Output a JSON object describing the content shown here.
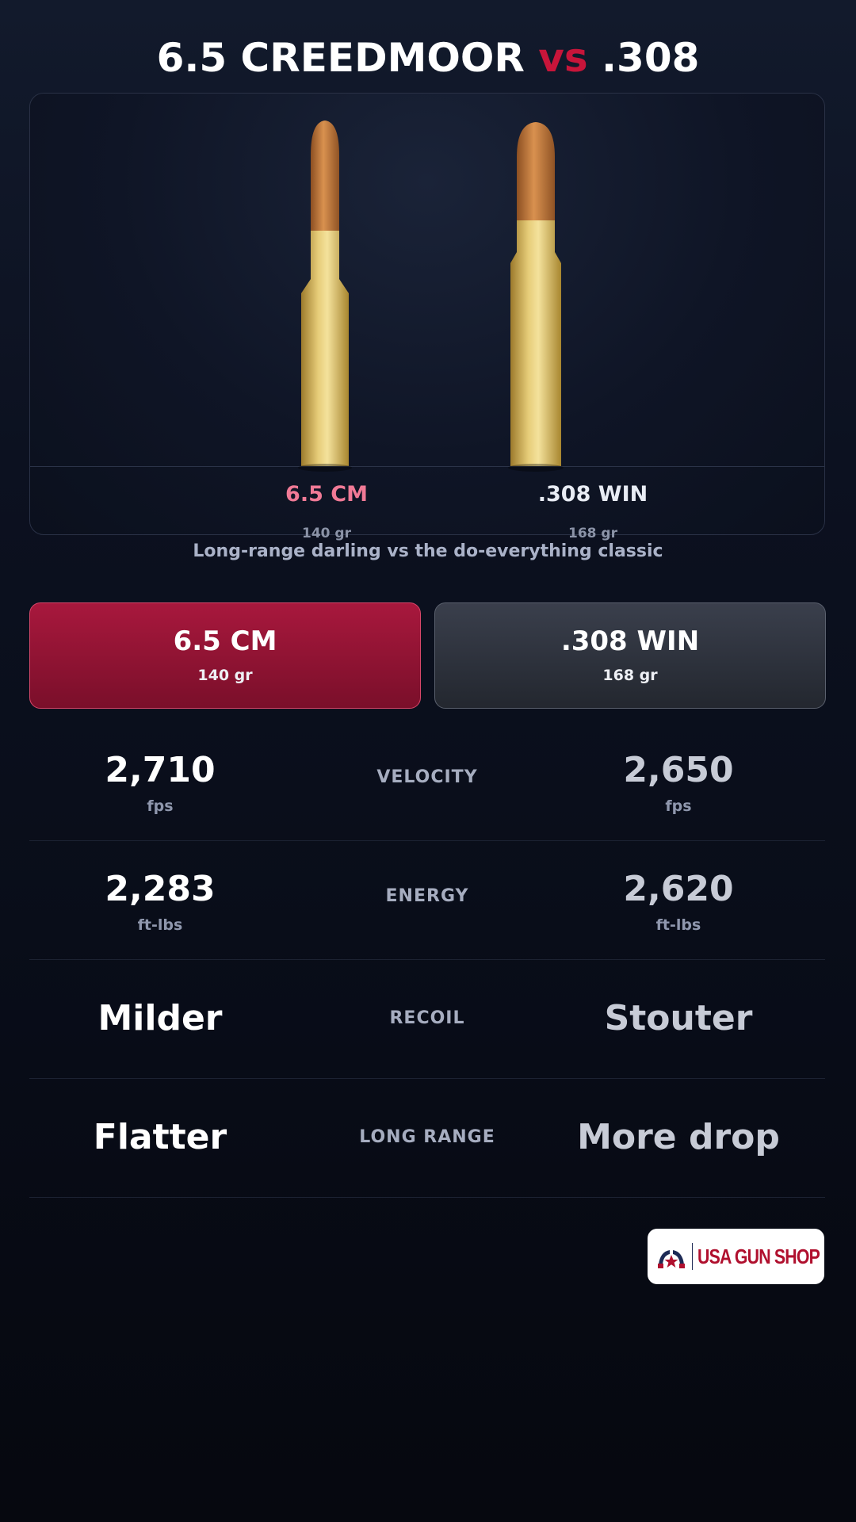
{
  "title": {
    "left": "6.5 CREEDMOOR",
    "vs": "vs",
    "right": ".308"
  },
  "colors": {
    "accent_red": "#c8153a",
    "left_label": "#f07a96",
    "brass": "#e2c56a",
    "copper": "#c27a3c"
  },
  "cartridges": {
    "left": {
      "label": "6.5 CM",
      "grain": "140 gr"
    },
    "right": {
      "label": ".308 WIN",
      "grain": "168 gr"
    }
  },
  "tagline": "Long-range darling vs the do-everything classic",
  "cards": {
    "left": {
      "name": "6.5 CM",
      "grain": "140 gr"
    },
    "right": {
      "name": ".308 WIN",
      "grain": "168 gr"
    }
  },
  "rows": [
    {
      "metric": "VELOCITY",
      "left": "2,710",
      "left_unit": "fps",
      "right": "2,650",
      "right_unit": "fps"
    },
    {
      "metric": "ENERGY",
      "left": "2,283",
      "left_unit": "ft-lbs",
      "right": "2,620",
      "right_unit": "ft-lbs"
    },
    {
      "metric": "RECOIL",
      "left": "Milder",
      "right": "Stouter"
    },
    {
      "metric": "LONG RANGE",
      "left": "Flatter",
      "right": "More drop"
    }
  ],
  "logo": {
    "text": "USA GUN SHOP",
    "icon": "revolvers-star-logo-icon"
  }
}
